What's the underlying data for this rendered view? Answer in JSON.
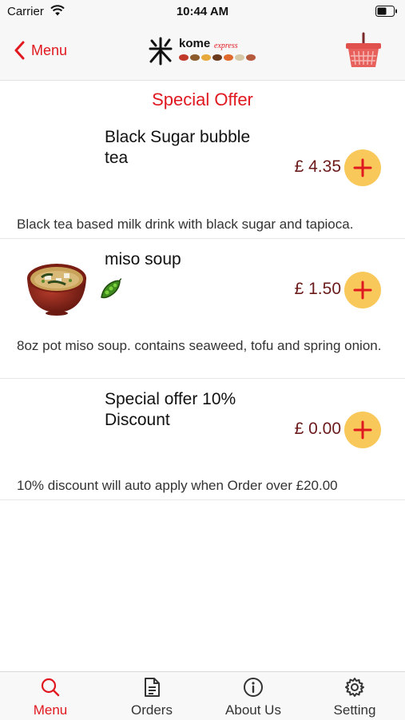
{
  "status_bar": {
    "carrier": "Carrier",
    "time": "10:44 AM"
  },
  "nav": {
    "back_label": "Menu",
    "logo_text": "kome",
    "logo_sub": "express"
  },
  "section_title": "Special Offer",
  "items": [
    {
      "name": "Black Sugar bubble tea",
      "price": "£ 4.35",
      "description": "Black tea based milk drink with black sugar and tapioca."
    },
    {
      "name": "miso soup",
      "price": "£ 1.50",
      "description": "8oz pot miso soup. contains seaweed, tofu and spring onion."
    },
    {
      "name": "Special offer 10% Discount",
      "price": "£ 0.00",
      "description": "10% discount will auto apply when Order over £20.00"
    }
  ],
  "tabs": [
    {
      "label": "Menu",
      "icon": "search-icon",
      "active": true
    },
    {
      "label": "Orders",
      "icon": "document-icon",
      "active": false
    },
    {
      "label": "About Us",
      "icon": "info-icon",
      "active": false
    },
    {
      "label": "Setting",
      "icon": "gear-icon",
      "active": false
    }
  ],
  "colors": {
    "accent": "#e0181f",
    "price": "#6b1a1a",
    "add_button": "#f8c95a"
  }
}
